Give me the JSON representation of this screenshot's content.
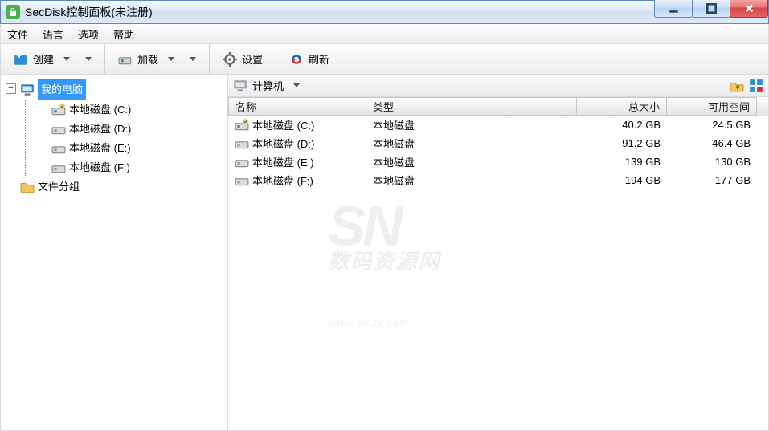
{
  "window": {
    "title": "SecDisk控制面板(未注册)"
  },
  "menu": {
    "file": "文件",
    "language": "语言",
    "options": "选项",
    "help": "帮助"
  },
  "toolbar": {
    "create": "创建",
    "load": "加载",
    "settings": "设置",
    "refresh": "刷新"
  },
  "tree": {
    "root_label": "我的电脑",
    "drives": [
      {
        "label": "本地磁盘 (C:)"
      },
      {
        "label": "本地磁盘 (D:)"
      },
      {
        "label": "本地磁盘 (E:)"
      },
      {
        "label": "本地磁盘 (F:)"
      }
    ],
    "folder_group": "文件分组"
  },
  "pathbar": {
    "label": "计算机"
  },
  "columns": {
    "name": "名称",
    "type": "类型",
    "size": "总大小",
    "free": "可用空间"
  },
  "rows": [
    {
      "name": "本地磁盘 (C:)",
      "type": "本地磁盘",
      "size": "40.2 GB",
      "free": "24.5 GB",
      "icon": "drive-system"
    },
    {
      "name": "本地磁盘 (D:)",
      "type": "本地磁盘",
      "size": "91.2 GB",
      "free": "46.4 GB",
      "icon": "drive"
    },
    {
      "name": "本地磁盘 (E:)",
      "type": "本地磁盘",
      "size": "139 GB",
      "free": "130 GB",
      "icon": "drive"
    },
    {
      "name": "本地磁盘 (F:)",
      "type": "本地磁盘",
      "size": "194 GB",
      "free": "177 GB",
      "icon": "drive"
    }
  ],
  "watermark": {
    "logo": "SN",
    "zh": "数码资源网",
    "url": "www.smzy.com"
  }
}
